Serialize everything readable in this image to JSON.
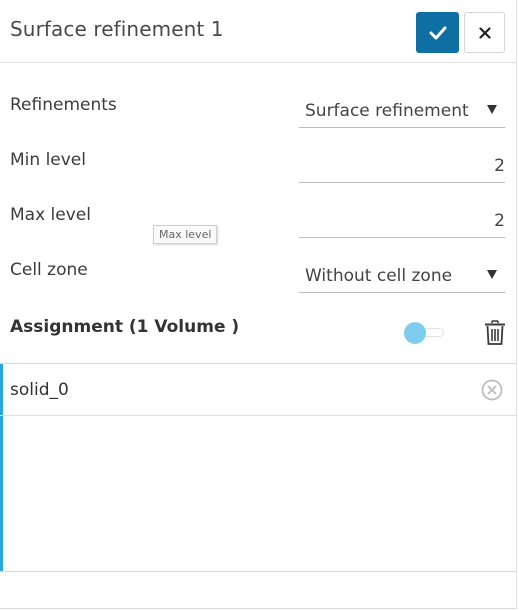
{
  "header": {
    "title": "Surface refinement 1",
    "confirm_icon": "check-icon",
    "close_icon": "close-icon"
  },
  "form": {
    "refinements": {
      "label": "Refinements",
      "value": "Surface refinement"
    },
    "min_level": {
      "label": "Min level",
      "value": "2"
    },
    "max_level": {
      "label": "Max level",
      "value": "2",
      "tooltip": "Max level"
    },
    "cell_zone": {
      "label": "Cell zone",
      "value": "Without cell zone"
    }
  },
  "assignment": {
    "title": "Assignment (1 Volume )",
    "toggle_on": false,
    "items": [
      {
        "label": "solid_0",
        "icon": "remove-circle-icon"
      }
    ]
  },
  "colors": {
    "primary": "#0f6fa3",
    "accent": "#29a8e0",
    "toggle_knob": "#7fcdee"
  }
}
